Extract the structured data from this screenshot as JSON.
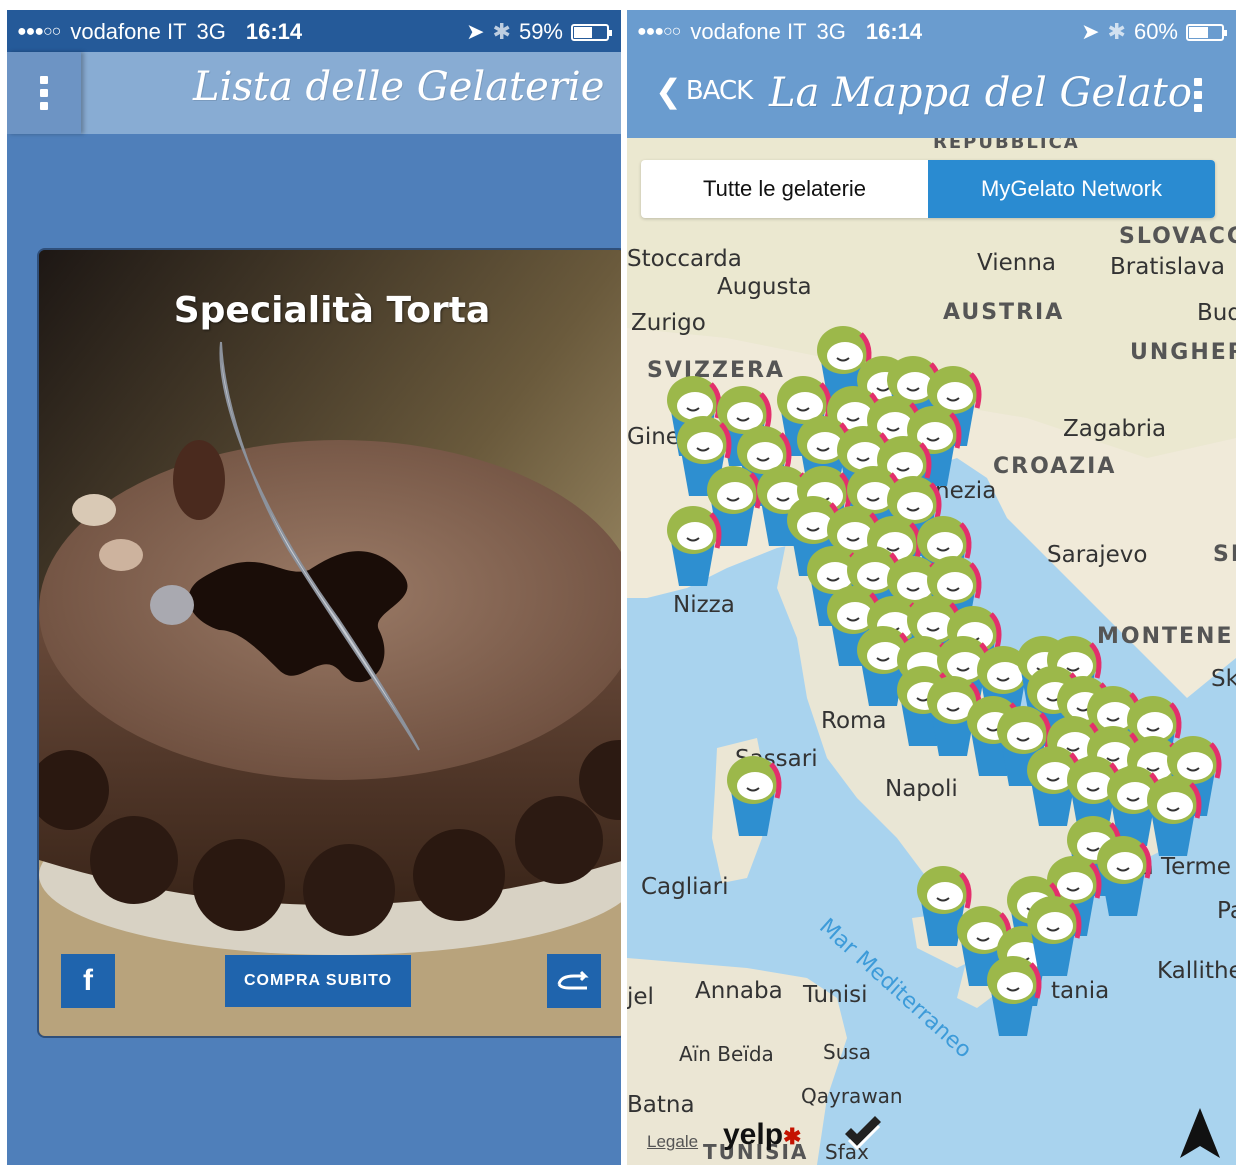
{
  "left_screen": {
    "status": {
      "signal": "●●●○○",
      "carrier": "vodafone IT",
      "network": "3G",
      "time": "16:14",
      "battery": "59%",
      "battery_level": 0.59
    },
    "nav": {
      "title": "Lista delle Gelaterie",
      "menu_icon": "vertical-dots-icon"
    },
    "card": {
      "title": "Specialità Torta",
      "facebook_label": "f",
      "buy_label": "COMPRA SUBITO",
      "share_icon": "share-icon"
    },
    "colors": {
      "background": "#4f7fba",
      "statusbar": "#255a99",
      "button": "#1f64ad"
    }
  },
  "right_screen": {
    "status": {
      "signal": "●●●○○",
      "carrier": "vodafone IT",
      "network": "3G",
      "time": "16:14",
      "battery": "60%",
      "battery_level": 0.6
    },
    "nav": {
      "back_label": "BACK",
      "title": "La Mappa del Gelato",
      "menu_icon": "vertical-dots-icon"
    },
    "segmented": {
      "option_all": "Tutte le gelaterie",
      "option_network": "MyGelato Network",
      "selected": "MyGelato Network"
    },
    "map_labels": {
      "stoccarda": "Stoccarda",
      "augusta": "Augusta",
      "zurigo": "Zurigo",
      "svizzera": "SVIZZERA",
      "ginevra": "Gine",
      "vienna": "Vienna",
      "bratislava": "Bratislava",
      "slovacchia": "SLOVACC",
      "austria": "AUSTRIA",
      "budapest": "Bud",
      "ungheria": "UNGHER",
      "zagabria": "Zagabria",
      "croazia": "CROAZIA",
      "venezia": "nezia",
      "sarajevo": "Sarajevo",
      "nizza": "Nizza",
      "montenegro": "MONTENE",
      "roma": "Roma",
      "sassari": "Sassari",
      "napoli": "Napoli",
      "cagliari": "Cagliari",
      "lamezia": "ezia Terme",
      "tunisi": "Tunisi",
      "annaba": "Annaba",
      "catania": "tania",
      "kallithea": "Kallithe",
      "ain_beida": "Aïn Beïda",
      "susa": "Susa",
      "qayrawan": "Qayrawan",
      "batna": "Batna",
      "tunisia": "TUNISIA",
      "sfax": "Sfax",
      "sea": "Mar Mediterraneo",
      "sk": "Sk",
      "pa": "Pa",
      "jel": "jel",
      "sl": "SL",
      "repubblica": "REPUBBLICA"
    },
    "attribution": {
      "legal": "Legale",
      "yelp": "yelp",
      "foursquare_icon": "foursquare-icon"
    },
    "location_icon": "location-arrow-icon",
    "marker_icon": "gelato-mascot-marker-icon"
  }
}
